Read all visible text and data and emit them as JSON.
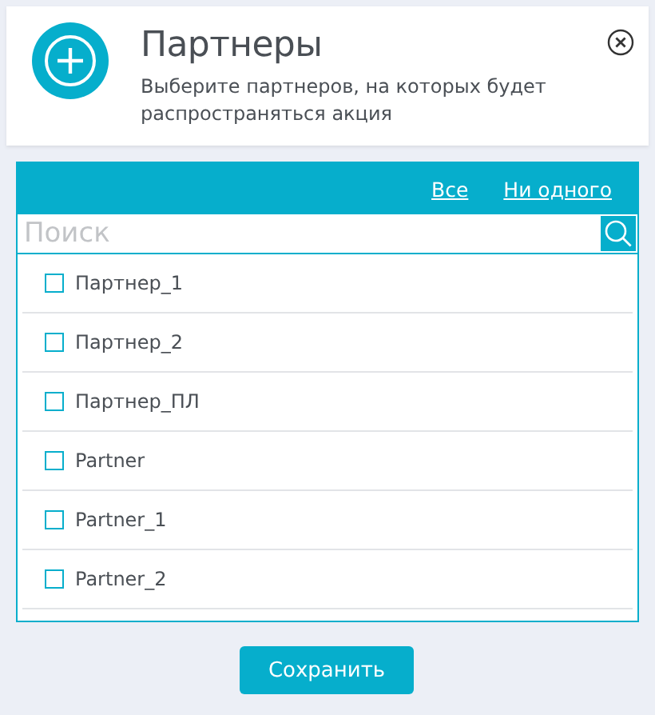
{
  "header": {
    "title": "Партнеры",
    "subtitle": "Выберите партнеров, на которых будет распространяться акция"
  },
  "links": [
    "Все",
    "Ни одного"
  ],
  "search": {
    "placeholder": "Поиск"
  },
  "partners": [
    {
      "label": "Партнер_1",
      "checked": false
    },
    {
      "label": "Партнер_2",
      "checked": false
    },
    {
      "label": "Партнер_ПЛ",
      "checked": false
    },
    {
      "label": "Partner",
      "checked": false
    },
    {
      "label": "Partner_1",
      "checked": false
    },
    {
      "label": "Partner_2",
      "checked": false
    }
  ],
  "save_button": "Сохранить"
}
